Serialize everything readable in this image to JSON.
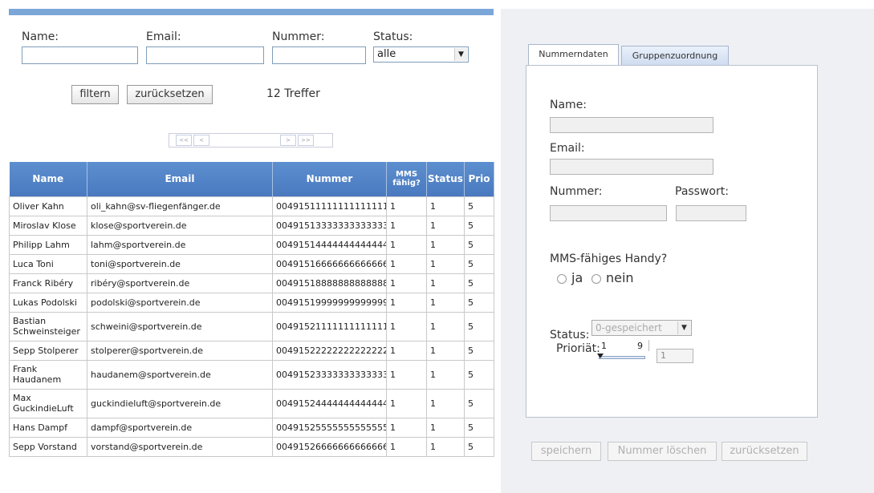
{
  "filter": {
    "name_label": "Name:",
    "email_label": "Email:",
    "nummer_label": "Nummer:",
    "status_label": "Status:",
    "name_value": "",
    "email_value": "",
    "nummer_value": "",
    "status_selected": "alle",
    "filter_button": "filtern",
    "reset_button": "zurücksetzen",
    "result_count": "12 Treffer"
  },
  "pager": {
    "first": "<<",
    "prev": "<",
    "next": ">",
    "last": ">>"
  },
  "table": {
    "columns": [
      "Name",
      "Email",
      "Nummer",
      "MMS fähig?",
      "Status",
      "Prio"
    ],
    "rows": [
      [
        "Oliver Kahn",
        "oli_kahn@sv-fliegenfänger.de",
        "00491511111111111111",
        "1",
        "1",
        "5"
      ],
      [
        "Miroslav Klose",
        "klose@sportverein.de",
        "00491513333333333333",
        "1",
        "1",
        "5"
      ],
      [
        "Philipp Lahm",
        "lahm@sportverein.de",
        "00491514444444444444",
        "1",
        "1",
        "5"
      ],
      [
        "Luca Toni",
        "toni@sportverein.de",
        "00491516666666666666",
        "1",
        "1",
        "5"
      ],
      [
        "Franck Ribéry",
        "ribéry@sportverein.de",
        "00491518888888888888",
        "1",
        "1",
        "5"
      ],
      [
        "Lukas Podolski",
        "podolski@sportverein.de",
        "00491519999999999999",
        "1",
        "1",
        "5"
      ],
      [
        "Bastian Schweinsteiger",
        "schweini@sportverein.de",
        "00491521111111111111",
        "1",
        "1",
        "5"
      ],
      [
        "Sepp Stolperer",
        "stolperer@sportverein.de",
        "00491522222222222222",
        "1",
        "1",
        "5"
      ],
      [
        "Frank Haudanem",
        "haudanem@sportverein.de",
        "00491523333333333333",
        "1",
        "1",
        "5"
      ],
      [
        "Max GuckindieLuft",
        "guckindieluft@sportverein.de",
        "00491524444444444444",
        "1",
        "1",
        "5"
      ],
      [
        "Hans Dampf",
        "dampf@sportverein.de",
        "00491525555555555555",
        "1",
        "1",
        "5"
      ],
      [
        "Sepp Vorstand",
        "vorstand@sportverein.de",
        "00491526666666666666",
        "1",
        "1",
        "5"
      ]
    ]
  },
  "detail": {
    "tabs": [
      "Nummerndaten",
      "Gruppenzuordnung"
    ],
    "name_label": "Name:",
    "email_label": "Email:",
    "nummer_label": "Nummer:",
    "passwort_label": "Passwort:",
    "mms_label": "MMS-fähiges Handy?",
    "mms_yes": "ja",
    "mms_no": "nein",
    "status_label": "Status:",
    "status_selected": "0-gespeichert",
    "prio_label": "Prioriät:",
    "prio_min": "1",
    "prio_max": "9",
    "prio_value": "1",
    "save_button": "speichern",
    "delete_button": "Nummer löschen",
    "reset_button": "zurücksetzen"
  }
}
